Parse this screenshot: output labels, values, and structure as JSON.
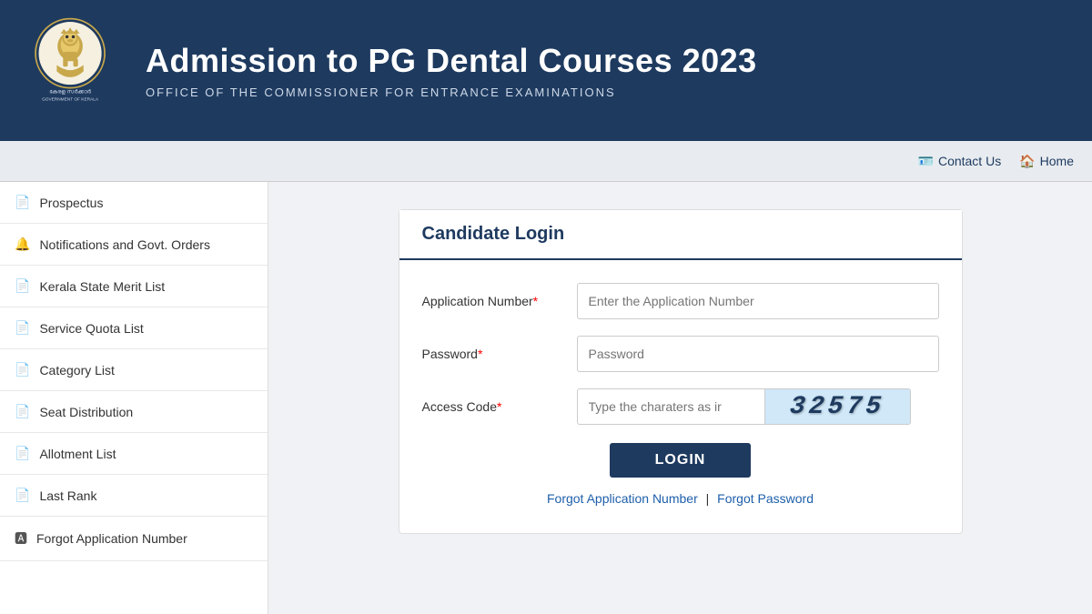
{
  "header": {
    "title": "Admission to PG Dental Courses 2023",
    "subtitle": "OFFICE OF THE COMMISSIONER FOR ENTRANCE EXAMINATIONS",
    "logo_alt": "Government of Kerala Logo",
    "logo_text": "കേരള സർക്കാർ\nGOVERNMENT OF KERALA"
  },
  "navbar": {
    "contact_us": "Contact Us",
    "home": "Home"
  },
  "sidebar": {
    "items": [
      {
        "id": "prospectus",
        "label": "Prospectus",
        "icon": "📄"
      },
      {
        "id": "notifications",
        "label": "Notifications and Govt. Orders",
        "icon": "🔔"
      },
      {
        "id": "kerala-merit",
        "label": "Kerala State Merit List",
        "icon": "📄"
      },
      {
        "id": "service-quota",
        "label": "Service Quota List",
        "icon": "📄"
      },
      {
        "id": "category-list",
        "label": "Category List",
        "icon": "📄"
      },
      {
        "id": "seat-distribution",
        "label": "Seat Distribution",
        "icon": "📄"
      },
      {
        "id": "allotment-list",
        "label": "Allotment List",
        "icon": "📄"
      },
      {
        "id": "last-rank",
        "label": "Last Rank",
        "icon": "📄"
      },
      {
        "id": "forgot-app",
        "label": "Forgot Application Number",
        "icon": "🅰"
      }
    ]
  },
  "login": {
    "title": "Candidate Login",
    "app_number_label": "Application Number",
    "app_number_placeholder": "Enter the Application Number",
    "password_label": "Password",
    "password_placeholder": "Password",
    "access_code_label": "Access Code",
    "access_code_placeholder": "Type the charaters as ir",
    "captcha_value": "32575",
    "login_button": "LOGIN",
    "forgot_app_link": "Forgot Application Number",
    "separator": "|",
    "forgot_password_link": "Forgot Password"
  }
}
